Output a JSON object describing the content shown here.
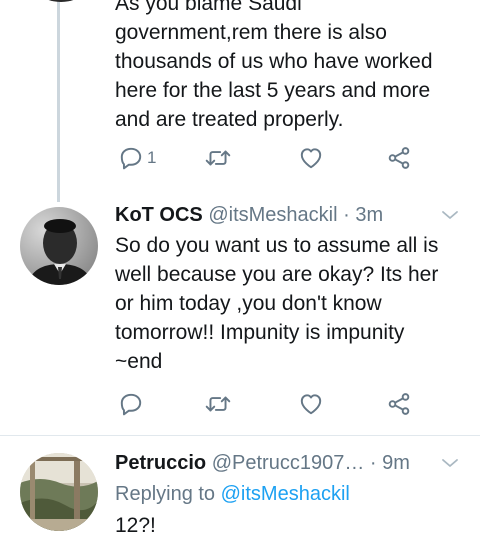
{
  "tweets": [
    {
      "text_lines": [
        "As you blame Saudi",
        "government,rem there is also",
        "thousands of us who have worked",
        "here for the last 5 years and more",
        "and are treated properly."
      ],
      "reply_count": "1"
    },
    {
      "name": "KoT OCS",
      "handle": "@itsMeshackil",
      "time": "· 3m",
      "text_lines": [
        "So do you want us to assume all is",
        "well because you are okay? Its her",
        "or him today ,you don't know",
        "tomorrow!! Impunity is impunity",
        "~end"
      ]
    },
    {
      "name": "Petruccio",
      "handle": "@Petrucc1907…",
      "time": "· 9m",
      "replying_prefix": "Replying to",
      "replying_mention": "@itsMeshackil",
      "text": "12?!"
    }
  ],
  "icons": {
    "reply": "reply-icon",
    "retweet": "retweet-icon",
    "like": "heart-icon",
    "share": "share-icon",
    "caret": "chevron-down-icon"
  },
  "colors": {
    "text": "#14171a",
    "secondary": "#657786",
    "link": "#1da1f2",
    "divider": "#e1e8ed",
    "thread_line": "#ccd6dd"
  }
}
